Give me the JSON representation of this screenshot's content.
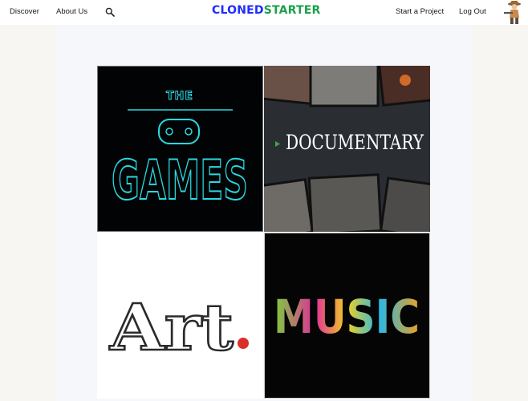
{
  "nav": {
    "discover": "Discover",
    "about": "About Us",
    "search_icon": "search-icon",
    "start_project": "Start a Project",
    "logout": "Log Out"
  },
  "logo": {
    "part1": "CLONED",
    "part2": "STARTER"
  },
  "categories": [
    {
      "name": "Games",
      "the": "THE",
      "word": "GAMES"
    },
    {
      "name": "Documentary",
      "word": "DOCUMENTARY"
    },
    {
      "name": "Art",
      "word": "Art"
    },
    {
      "name": "Music",
      "word": "MUSIC"
    }
  ],
  "colors": {
    "logo_blue": "#1f2cff",
    "logo_green": "#1ba14a",
    "neon_cyan": "#2ad8e0",
    "documentary_arrow": "#3aa84a"
  }
}
